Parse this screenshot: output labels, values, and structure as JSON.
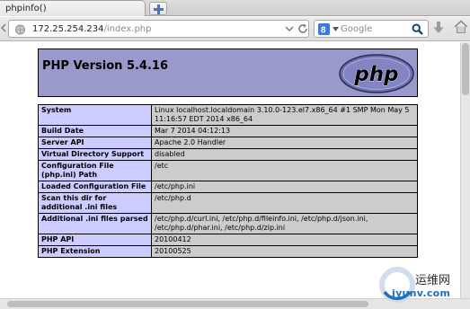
{
  "tab": {
    "title": "phpinfo()"
  },
  "address": {
    "host": "172.25.254.234",
    "path": "/index.php"
  },
  "search": {
    "placeholder": "Google",
    "engine_icon": "google-icon"
  },
  "php": {
    "title": "PHP Version 5.4.16",
    "logo_text": "php"
  },
  "info_rows": [
    {
      "key": "System",
      "value": "Linux localhost.localdomain 3.10.0-123.el7.x86_64 #1 SMP Mon May 5 11:16:57 EDT 2014 x86_64"
    },
    {
      "key": "Build Date",
      "value": "Mar 7 2014 04:12:13"
    },
    {
      "key": "Server API",
      "value": "Apache 2.0 Handler"
    },
    {
      "key": "Virtual Directory Support",
      "value": "disabled"
    },
    {
      "key": "Configuration File (php.ini) Path",
      "value": "/etc"
    },
    {
      "key": "Loaded Configuration File",
      "value": "/etc/php.ini"
    },
    {
      "key": "Scan this dir for additional .ini files",
      "value": "/etc/php.d"
    },
    {
      "key": "Additional .ini files parsed",
      "value": "/etc/php.d/curl.ini, /etc/php.d/fileinfo.ini, /etc/php.d/json.ini, /etc/php.d/phar.ini, /etc/php.d/zip.ini"
    },
    {
      "key": "PHP API",
      "value": "20100412"
    },
    {
      "key": "PHP Extension",
      "value": "20100525"
    }
  ],
  "watermark": {
    "cn": "运维网",
    "url": "iyunv.com"
  },
  "colors": {
    "header_bg": "#9999cc",
    "key_cell_bg": "#ccccff",
    "value_cell_bg": "#cccccc"
  }
}
